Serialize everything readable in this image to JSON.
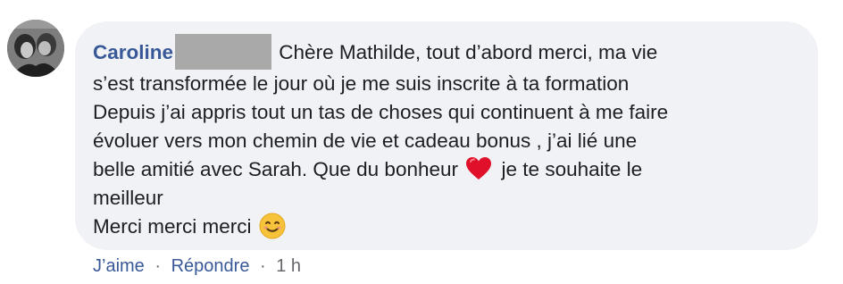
{
  "comment": {
    "author": "Caroline",
    "lines": [
      "Chère Mathilde, tout d’abord merci, ma vie",
      "s’est transformée le jour où je me suis inscrite à ta formation",
      "Depuis j’ai appris tout un tas de choses qui continuent à me faire",
      "évoluer vers mon chemin de vie et cadeau bonus , j’ai lié une",
      "belle amitié avec Sarah. Que du bonheur",
      "je te souhaite le",
      "meilleur",
      "Merci merci merci"
    ]
  },
  "actions": {
    "like_label": "J’aime",
    "reply_label": "Répondre",
    "separator": "·",
    "timestamp": "1 h"
  },
  "colors": {
    "bubble_bg": "#f0f2f5",
    "author": "#385898",
    "text": "#1c1e21",
    "meta": "#65676b",
    "heart": "#e0102a",
    "emoji": "#f7c33a"
  },
  "icons": {
    "heart": "red-heart-emoji",
    "smile": "smiling-face-emoji"
  }
}
